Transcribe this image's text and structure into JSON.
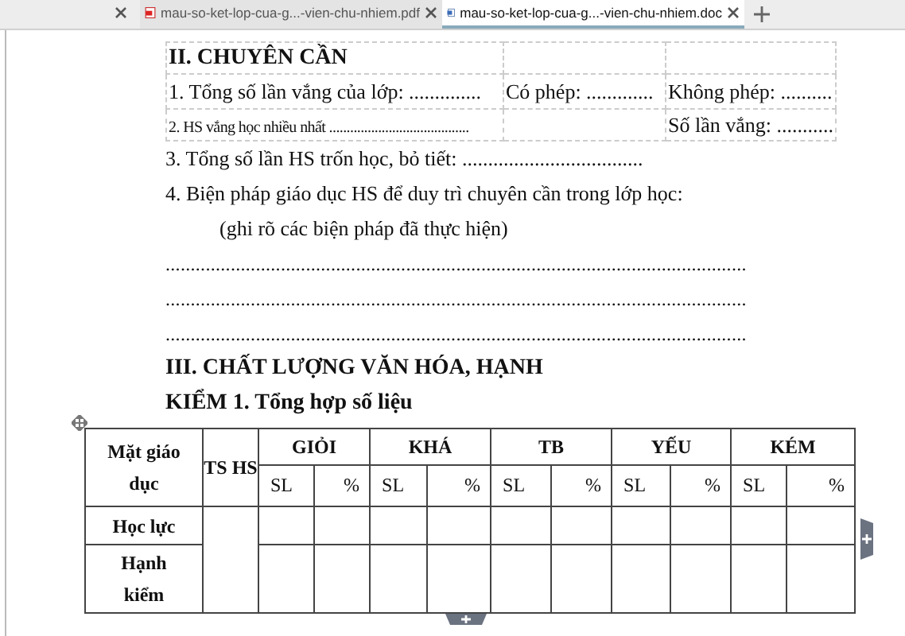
{
  "tabs": [
    {
      "kind": "partial"
    },
    {
      "kind": "pdf",
      "label": "mau-so-ket-lop-cua-g...-vien-chu-nhiem.pdf",
      "selected": false
    },
    {
      "kind": "doc",
      "label": "mau-so-ket-lop-cua-g...-vien-chu-nhiem.doc",
      "selected": true
    }
  ],
  "document": {
    "section_2_table": [
      {
        "left": "II. CHUYÊN CẦN"
      },
      {
        "left": "1. Tổng số lần vắng của lớp: ..............",
        "middle": "Có phép: .............",
        "right": "Không phép: .........."
      },
      {
        "left": "2. HS vắng học nhiều nhất ........................................",
        "right": "Số lần vắng: ..........."
      }
    ],
    "lines": [
      {
        "kind": "text",
        "text": "3. Tổng số lần HS trốn học, bỏ tiết: ..................................."
      },
      {
        "kind": "text",
        "text": "4. Biện pháp giáo dục HS để duy trì chuyên cần trong lớp học:"
      },
      {
        "kind": "indent",
        "text": "(ghi rõ các biện pháp đã thực hiện)"
      },
      {
        "kind": "dots",
        "text": "...................................................................................................................."
      },
      {
        "kind": "dots",
        "text": "...................................................................................................................."
      },
      {
        "kind": "dots",
        "text": "...................................................................................................................."
      },
      {
        "kind": "heading",
        "text": "III. CHẤT LƯỢNG VĂN HÓA, HẠNH"
      },
      {
        "kind": "heading",
        "text": "KIỂM 1. Tổng hợp số liệu"
      }
    ],
    "table": {
      "col_1": "Mặt giáo dục",
      "col_2": "TS HS",
      "groups": [
        {
          "label": "GIỎI",
          "sub": [
            "SL",
            "%"
          ]
        },
        {
          "label": "KHÁ",
          "sub": [
            "SL",
            "%"
          ]
        },
        {
          "label": "TB",
          "sub": [
            "SL",
            "%"
          ]
        },
        {
          "label": "YẾU",
          "sub": [
            "SL",
            "%"
          ]
        },
        {
          "label": "KÉM",
          "sub": [
            "SL",
            "%"
          ]
        }
      ],
      "rows": [
        "Học lực",
        "Hạnh kiểm"
      ]
    }
  }
}
